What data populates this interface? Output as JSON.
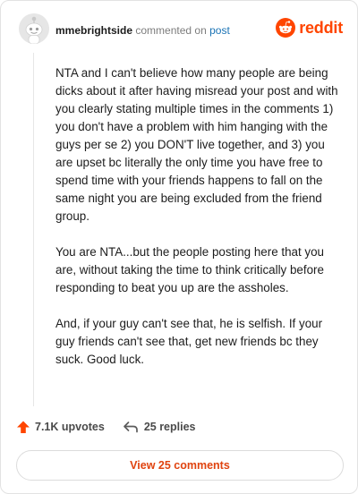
{
  "header": {
    "username": "mmebrightside",
    "action_text": "commented on",
    "post_link": "post",
    "logo_text": "reddit"
  },
  "comment": {
    "paragraphs": [
      "NTA and I can't believe how many people are being dicks about it after having misread your post and with you clearly stating multiple times in the comments 1) you don't have a problem with him hanging with the guys per se 2) you DON'T live together, and 3) you are upset bc literally the only time you have free to spend time with your friends happens to fall on the same night you are being excluded from the friend group.",
      "You are NTA...but the people posting here that you are, without taking the time to think critically before responding to beat you up are the assholes.",
      "And, if your guy can't see that, he is selfish. If your guy friends can't see that, get new friends bc they suck. Good luck."
    ]
  },
  "actions": {
    "upvotes": "7.1K upvotes",
    "replies": "25 replies"
  },
  "view_comments_label": "View 25 comments",
  "colors": {
    "brand": "#ff4500",
    "link": "#1a73b5",
    "button_text": "#e0430f"
  }
}
